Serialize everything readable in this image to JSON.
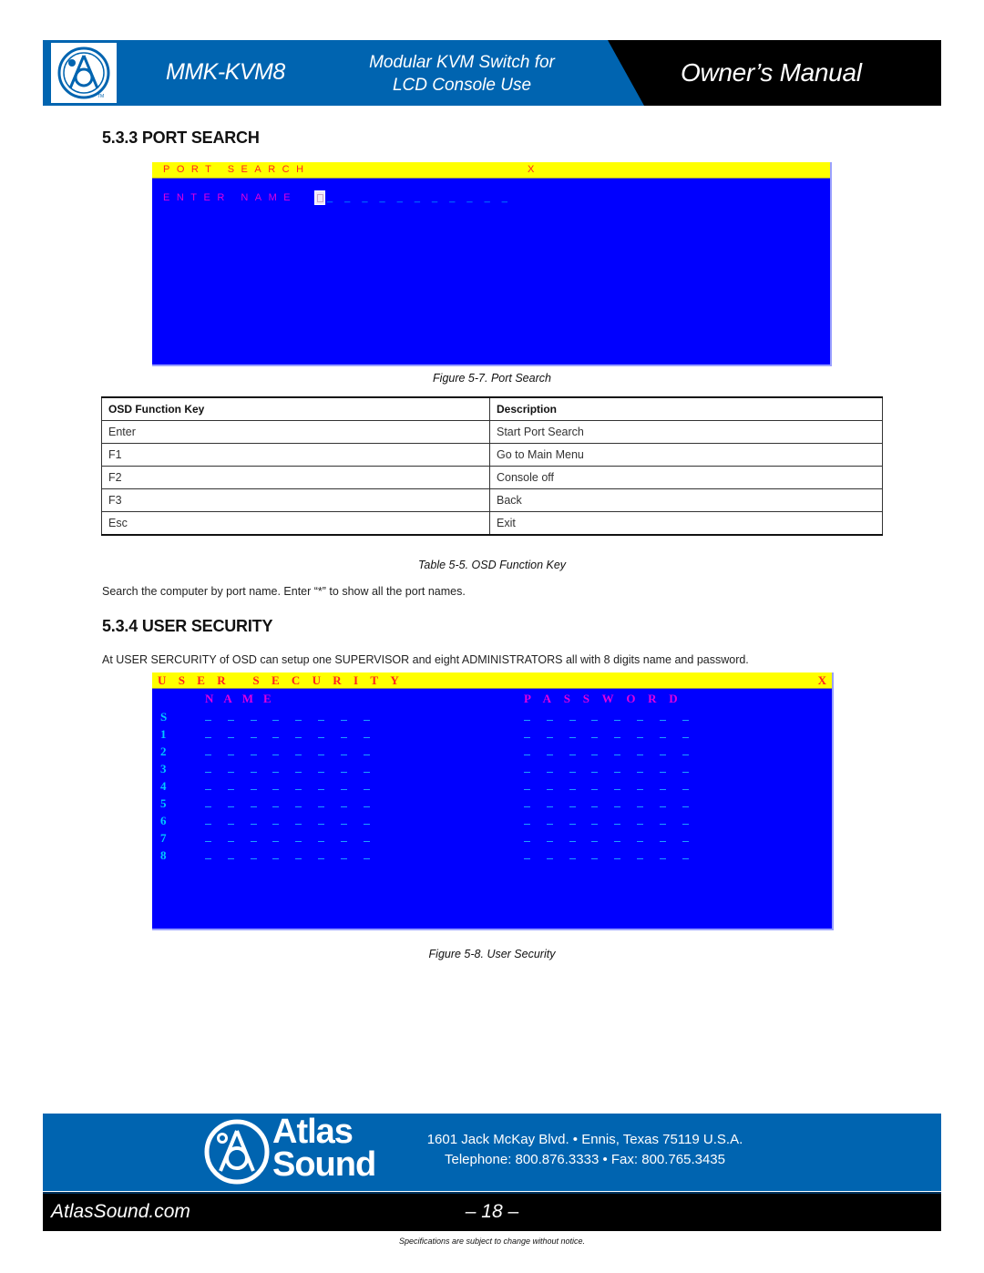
{
  "header": {
    "model": "MMK-KVM8",
    "subtitle_line1": "Modular KVM Switch for",
    "subtitle_line2": "LCD Console Use",
    "manual_title": "Owner’s Manual",
    "logo_icon": "atlas-sound-logo-icon",
    "colors": {
      "blue": "#0064b0",
      "black": "#000000"
    }
  },
  "port_search": {
    "heading": "5.3.3  PORT SEARCH",
    "osd": {
      "title": "PORT SEARCH",
      "close": "X",
      "label": "ENTER NAME",
      "blanks": "_ _ _ _ _ _ _ _ _ _ _",
      "colors": {
        "background": "#0000ff",
        "title_bar": "#ffff00",
        "title_text": "#ff2020",
        "label_text": "#e000e0",
        "blank": "#00a0ff"
      }
    },
    "figure_caption": "Figure 5-7. Port Search"
  },
  "function_table": {
    "headers": [
      "OSD Function Key",
      "Description"
    ],
    "rows": [
      [
        "Enter",
        "Start Port Search"
      ],
      [
        "F1",
        "Go to Main Menu"
      ],
      [
        "F2",
        "Console off"
      ],
      [
        "F3",
        "Back"
      ],
      [
        "Esc",
        "Exit"
      ]
    ],
    "caption": "Table 5-5. OSD Function Key"
  },
  "port_search_text": "Search the computer by port name. Enter “*” to show all the port names.",
  "user_security": {
    "heading": "5.3.4  USER SECURITY",
    "text": "At USER SERCURITY of OSD can setup one SUPERVISOR and eight ADMINISTRATORS all with 8 digits name and password.",
    "osd": {
      "title": "USER SECURITY",
      "close": "X",
      "name_header": "NAME",
      "password_header": "PASSWORD",
      "rows": [
        "S",
        "1",
        "2",
        "3",
        "4",
        "5",
        "6",
        "7",
        "8"
      ],
      "digits_per_field": 8,
      "colors": {
        "background": "#0000ff",
        "title_bar": "#ffff00",
        "title_text": "#ff2020",
        "header_text": "#e000e0",
        "row_index": "#00c8ff",
        "blank": "#1fa0ff"
      }
    },
    "figure_caption": "Figure 5-8. User Security"
  },
  "footer": {
    "brand_line1": "Atlas",
    "brand_line2": "Sound",
    "address": "1601 Jack McKay Blvd. • Ennis, Texas 75119  U.S.A.",
    "phone": "Telephone: 800.876.3333 • Fax: 800.765.3435",
    "website": "AtlasSound.com",
    "page_number": "– 18 –",
    "notice": "Specifications are subject to change without notice."
  }
}
